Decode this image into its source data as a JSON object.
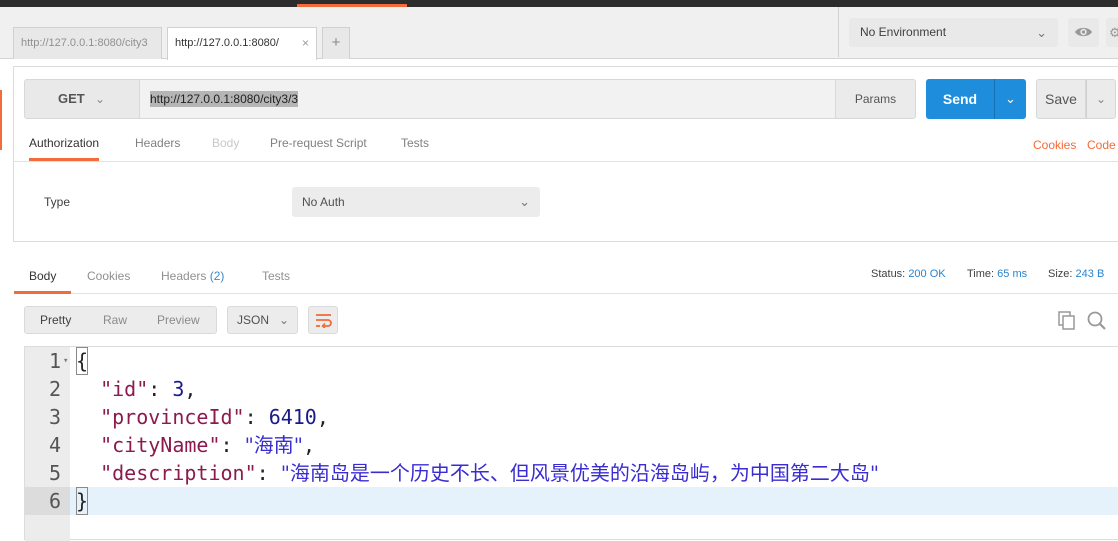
{
  "tabs": {
    "inactive_label": "http://127.0.0.1:8080/city3",
    "active_label": "http://127.0.0.1:8080/",
    "close_glyph": "×",
    "add_glyph": "+"
  },
  "environment": {
    "label": "No Environment",
    "eye_icon": "eye-icon",
    "gear_icon": "gear-icon"
  },
  "request": {
    "method": "GET",
    "url": "http://127.0.0.1:8080/city3/3",
    "params_label": "Params",
    "send_label": "Send",
    "save_label": "Save"
  },
  "request_tabs": [
    {
      "label": "Authorization",
      "state": "active"
    },
    {
      "label": "Headers",
      "state": "normal"
    },
    {
      "label": "Body",
      "state": "disabled"
    },
    {
      "label": "Pre-request Script",
      "state": "normal"
    },
    {
      "label": "Tests",
      "state": "normal"
    }
  ],
  "links": {
    "cookies": "Cookies",
    "code": "Code"
  },
  "auth": {
    "type_label": "Type",
    "type_value": "No Auth"
  },
  "response_tabs": {
    "body": "Body",
    "cookies": "Cookies",
    "headers": "Headers",
    "headers_count": "(2)",
    "tests": "Tests"
  },
  "response_meta": {
    "status_label": "Status:",
    "status_value": "200 OK",
    "time_label": "Time:",
    "time_value": "65 ms",
    "size_label": "Size:",
    "size_value": "243 B"
  },
  "view": {
    "pretty": "Pretty",
    "raw": "Raw",
    "preview": "Preview",
    "format": "JSON"
  },
  "editor": {
    "lines": [
      {
        "num": "1",
        "text": "{"
      },
      {
        "num": "2",
        "key": "\"id\"",
        "value": "3",
        "value_type": "number"
      },
      {
        "num": "3",
        "key": "\"provinceId\"",
        "value": "6410",
        "value_type": "number"
      },
      {
        "num": "4",
        "key": "\"cityName\"",
        "value": "\"海南\"",
        "value_type": "string"
      },
      {
        "num": "5",
        "key": "\"description\"",
        "value": "\"海南岛是一个历史不长、但风景优美的沿海岛屿，为中国第二大岛\"",
        "value_type": "string"
      },
      {
        "num": "6",
        "text": "}"
      }
    ]
  },
  "colors": {
    "accent": "#f26b3a",
    "send": "#1d8ddc",
    "status_value": "#2784d0",
    "json_key": "#8c1a4e",
    "json_number": "#1a1a8a",
    "json_string": "#3a2cd0"
  }
}
